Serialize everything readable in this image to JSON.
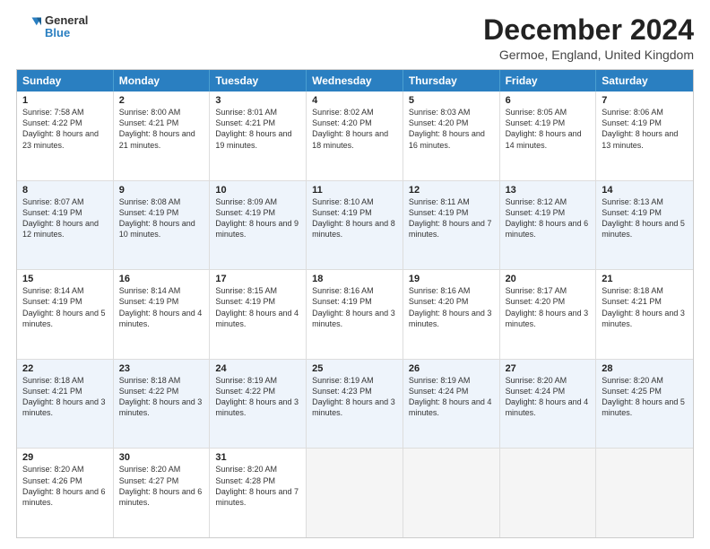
{
  "logo": {
    "general": "General",
    "blue": "Blue"
  },
  "title": {
    "month": "December 2024",
    "location": "Germoe, England, United Kingdom"
  },
  "calendar": {
    "headers": [
      "Sunday",
      "Monday",
      "Tuesday",
      "Wednesday",
      "Thursday",
      "Friday",
      "Saturday"
    ],
    "rows": [
      [
        {
          "day": "1",
          "sunrise": "7:58 AM",
          "sunset": "4:22 PM",
          "daylight": "8 hours and 23 minutes."
        },
        {
          "day": "2",
          "sunrise": "8:00 AM",
          "sunset": "4:21 PM",
          "daylight": "8 hours and 21 minutes."
        },
        {
          "day": "3",
          "sunrise": "8:01 AM",
          "sunset": "4:21 PM",
          "daylight": "8 hours and 19 minutes."
        },
        {
          "day": "4",
          "sunrise": "8:02 AM",
          "sunset": "4:20 PM",
          "daylight": "8 hours and 18 minutes."
        },
        {
          "day": "5",
          "sunrise": "8:03 AM",
          "sunset": "4:20 PM",
          "daylight": "8 hours and 16 minutes."
        },
        {
          "day": "6",
          "sunrise": "8:05 AM",
          "sunset": "4:19 PM",
          "daylight": "8 hours and 14 minutes."
        },
        {
          "day": "7",
          "sunrise": "8:06 AM",
          "sunset": "4:19 PM",
          "daylight": "8 hours and 13 minutes."
        }
      ],
      [
        {
          "day": "8",
          "sunrise": "8:07 AM",
          "sunset": "4:19 PM",
          "daylight": "8 hours and 12 minutes."
        },
        {
          "day": "9",
          "sunrise": "8:08 AM",
          "sunset": "4:19 PM",
          "daylight": "8 hours and 10 minutes."
        },
        {
          "day": "10",
          "sunrise": "8:09 AM",
          "sunset": "4:19 PM",
          "daylight": "8 hours and 9 minutes."
        },
        {
          "day": "11",
          "sunrise": "8:10 AM",
          "sunset": "4:19 PM",
          "daylight": "8 hours and 8 minutes."
        },
        {
          "day": "12",
          "sunrise": "8:11 AM",
          "sunset": "4:19 PM",
          "daylight": "8 hours and 7 minutes."
        },
        {
          "day": "13",
          "sunrise": "8:12 AM",
          "sunset": "4:19 PM",
          "daylight": "8 hours and 6 minutes."
        },
        {
          "day": "14",
          "sunrise": "8:13 AM",
          "sunset": "4:19 PM",
          "daylight": "8 hours and 5 minutes."
        }
      ],
      [
        {
          "day": "15",
          "sunrise": "8:14 AM",
          "sunset": "4:19 PM",
          "daylight": "8 hours and 5 minutes."
        },
        {
          "day": "16",
          "sunrise": "8:14 AM",
          "sunset": "4:19 PM",
          "daylight": "8 hours and 4 minutes."
        },
        {
          "day": "17",
          "sunrise": "8:15 AM",
          "sunset": "4:19 PM",
          "daylight": "8 hours and 4 minutes."
        },
        {
          "day": "18",
          "sunrise": "8:16 AM",
          "sunset": "4:19 PM",
          "daylight": "8 hours and 3 minutes."
        },
        {
          "day": "19",
          "sunrise": "8:16 AM",
          "sunset": "4:20 PM",
          "daylight": "8 hours and 3 minutes."
        },
        {
          "day": "20",
          "sunrise": "8:17 AM",
          "sunset": "4:20 PM",
          "daylight": "8 hours and 3 minutes."
        },
        {
          "day": "21",
          "sunrise": "8:18 AM",
          "sunset": "4:21 PM",
          "daylight": "8 hours and 3 minutes."
        }
      ],
      [
        {
          "day": "22",
          "sunrise": "8:18 AM",
          "sunset": "4:21 PM",
          "daylight": "8 hours and 3 minutes."
        },
        {
          "day": "23",
          "sunrise": "8:18 AM",
          "sunset": "4:22 PM",
          "daylight": "8 hours and 3 minutes."
        },
        {
          "day": "24",
          "sunrise": "8:19 AM",
          "sunset": "4:22 PM",
          "daylight": "8 hours and 3 minutes."
        },
        {
          "day": "25",
          "sunrise": "8:19 AM",
          "sunset": "4:23 PM",
          "daylight": "8 hours and 3 minutes."
        },
        {
          "day": "26",
          "sunrise": "8:19 AM",
          "sunset": "4:24 PM",
          "daylight": "8 hours and 4 minutes."
        },
        {
          "day": "27",
          "sunrise": "8:20 AM",
          "sunset": "4:24 PM",
          "daylight": "8 hours and 4 minutes."
        },
        {
          "day": "28",
          "sunrise": "8:20 AM",
          "sunset": "4:25 PM",
          "daylight": "8 hours and 5 minutes."
        }
      ],
      [
        {
          "day": "29",
          "sunrise": "8:20 AM",
          "sunset": "4:26 PM",
          "daylight": "8 hours and 6 minutes."
        },
        {
          "day": "30",
          "sunrise": "8:20 AM",
          "sunset": "4:27 PM",
          "daylight": "8 hours and 6 minutes."
        },
        {
          "day": "31",
          "sunrise": "8:20 AM",
          "sunset": "4:28 PM",
          "daylight": "8 hours and 7 minutes."
        },
        null,
        null,
        null,
        null
      ]
    ]
  }
}
